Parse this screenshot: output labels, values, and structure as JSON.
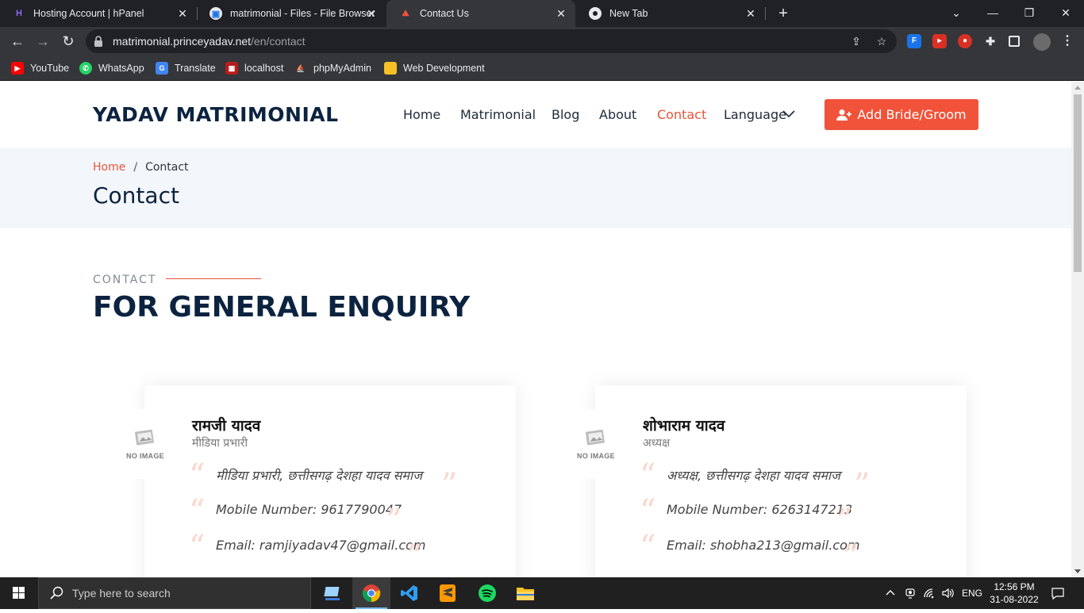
{
  "browser": {
    "tabs": [
      {
        "title": "Hosting Account | hPanel"
      },
      {
        "title": "matrimonial - Files - File Browser"
      },
      {
        "title": "Contact Us"
      },
      {
        "title": "New Tab"
      }
    ],
    "url_host": "matrimonial.princeyadav.net",
    "url_path": "/en/contact",
    "bookmarks": [
      {
        "label": "YouTube"
      },
      {
        "label": "WhatsApp"
      },
      {
        "label": "Translate"
      },
      {
        "label": "localhost"
      },
      {
        "label": "phpMyAdmin"
      },
      {
        "label": "Web Development"
      }
    ]
  },
  "site": {
    "brand": "YADAV MATRIMONIAL",
    "nav": {
      "home": "Home",
      "matrimonial": "Matrimonial",
      "blog": "Blog",
      "about": "About",
      "contact": "Contact",
      "language": "Language"
    },
    "cta_label": "Add Bride/Groom",
    "accent_color": "#f0533a",
    "breadcrumb": {
      "home": "Home",
      "current": "Contact"
    },
    "page_title": "Contact",
    "section": {
      "eyebrow": "CONTACT",
      "title": "FOR GENERAL ENQUIRY"
    },
    "no_image_label": "NO IMAGE",
    "contacts": [
      {
        "name": "रामजी यादव",
        "role": "मीडिया प्रभारी",
        "lines": [
          "मीडिया प्रभारी, छत्तीसगढ़ देशहा यादव समाज",
          "Mobile Number: 9617790047",
          "Email: ramjiyadav47@gmail.com"
        ]
      },
      {
        "name": "शोभाराम यादव",
        "role": "अध्यक्ष",
        "lines": [
          "अध्यक्ष, छत्तीसगढ़ देशहा यादव समाज",
          "Mobile Number: 6263147213",
          "Email: shobha213@gmail.com"
        ]
      }
    ]
  },
  "taskbar": {
    "search_placeholder": "Type here to search",
    "language": "ENG",
    "time": "12:56 PM",
    "date": "31-08-2022"
  }
}
